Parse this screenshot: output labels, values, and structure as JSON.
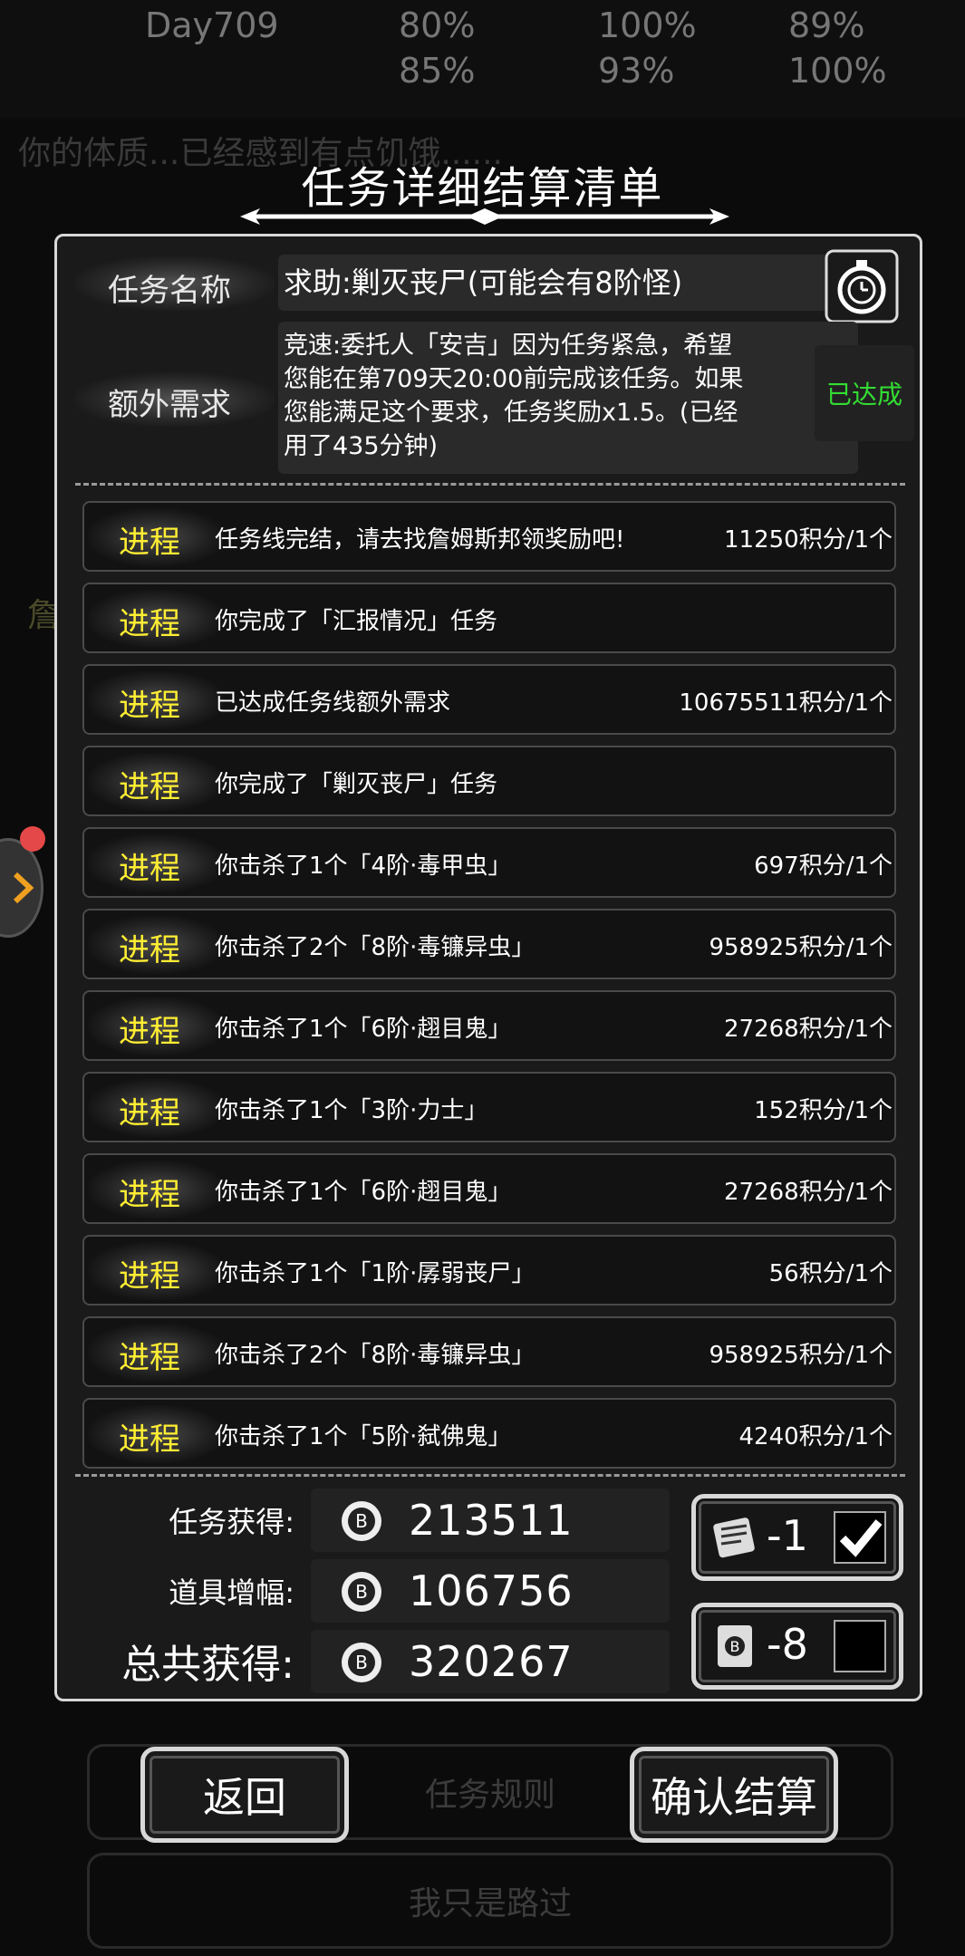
{
  "background": {
    "day_label": "Day709",
    "stat_values": [
      "80%",
      "100%",
      "89%",
      "85%",
      "93%",
      "100%"
    ],
    "notice_text": "你的体质...已经感到有点饥饿......",
    "side_panel_char": "詹",
    "rules_button": "任务规则",
    "pass_button": "我只是路过"
  },
  "dialog": {
    "title": "任务详细结算清单",
    "task_name_label": "任务名称",
    "task_name": "求助:剿灭丧尸(可能会有8阶怪)",
    "extra_label": "额外需求",
    "extra_lines": [
      "竞速:委托人「安吉」因为任务紧急，希望",
      "您能在第709天20:00前完成该任务。如果",
      "您能满足这个要求，任务奖励x1.5。(已经",
      "用了435分钟)"
    ],
    "extra_status": "已达成",
    "progress": [
      {
        "tag": "进程",
        "text": "任务线完结，请去找詹姆斯邦领奖励吧!",
        "score": "11250积分/1个"
      },
      {
        "tag": "进程",
        "text": "你完成了「汇报情况」任务",
        "score": ""
      },
      {
        "tag": "进程",
        "text": "已达成任务线额外需求",
        "score": "10675511积分/1个"
      },
      {
        "tag": "进程",
        "text": "你完成了「剿灭丧尸」任务",
        "score": ""
      },
      {
        "tag": "进程",
        "text": "你击杀了1个「4阶·毒甲虫」",
        "score": "697积分/1个"
      },
      {
        "tag": "进程",
        "text": "你击杀了2个「8阶·毒镰异虫」",
        "score": "958925积分/1个"
      },
      {
        "tag": "进程",
        "text": "你击杀了1个「6阶·趐目鬼」",
        "score": "27268积分/1个"
      },
      {
        "tag": "进程",
        "text": "你击杀了1个「3阶·力士」",
        "score": "152积分/1个"
      },
      {
        "tag": "进程",
        "text": "你击杀了1个「6阶·趐目鬼」",
        "score": "27268积分/1个"
      },
      {
        "tag": "进程",
        "text": "你击杀了1个「1阶·孱弱丧尸」",
        "score": "56积分/1个"
      },
      {
        "tag": "进程",
        "text": "你击杀了2个「8阶·毒镰异虫」",
        "score": "958925积分/1个"
      },
      {
        "tag": "进程",
        "text": "你击杀了1个「5阶·弑佛鬼」",
        "score": "4240积分/1个"
      }
    ],
    "summary": {
      "earned_label": "任务获得:",
      "earned_value": "213511",
      "bonus_label": "道具增幅:",
      "bonus_value": "106756",
      "total_label": "总共获得:",
      "total_value": "320267"
    },
    "items": [
      {
        "count": "-1",
        "checked": true,
        "icon": "scroll-icon"
      },
      {
        "count": "-8",
        "checked": false,
        "icon": "card-icon"
      }
    ],
    "back_button": "返回",
    "confirm_button": "确认结算"
  },
  "colors": {
    "tag_yellow": "#ffee33",
    "achieved_green": "#33dd33",
    "panel_border": "#d8d8d8"
  }
}
